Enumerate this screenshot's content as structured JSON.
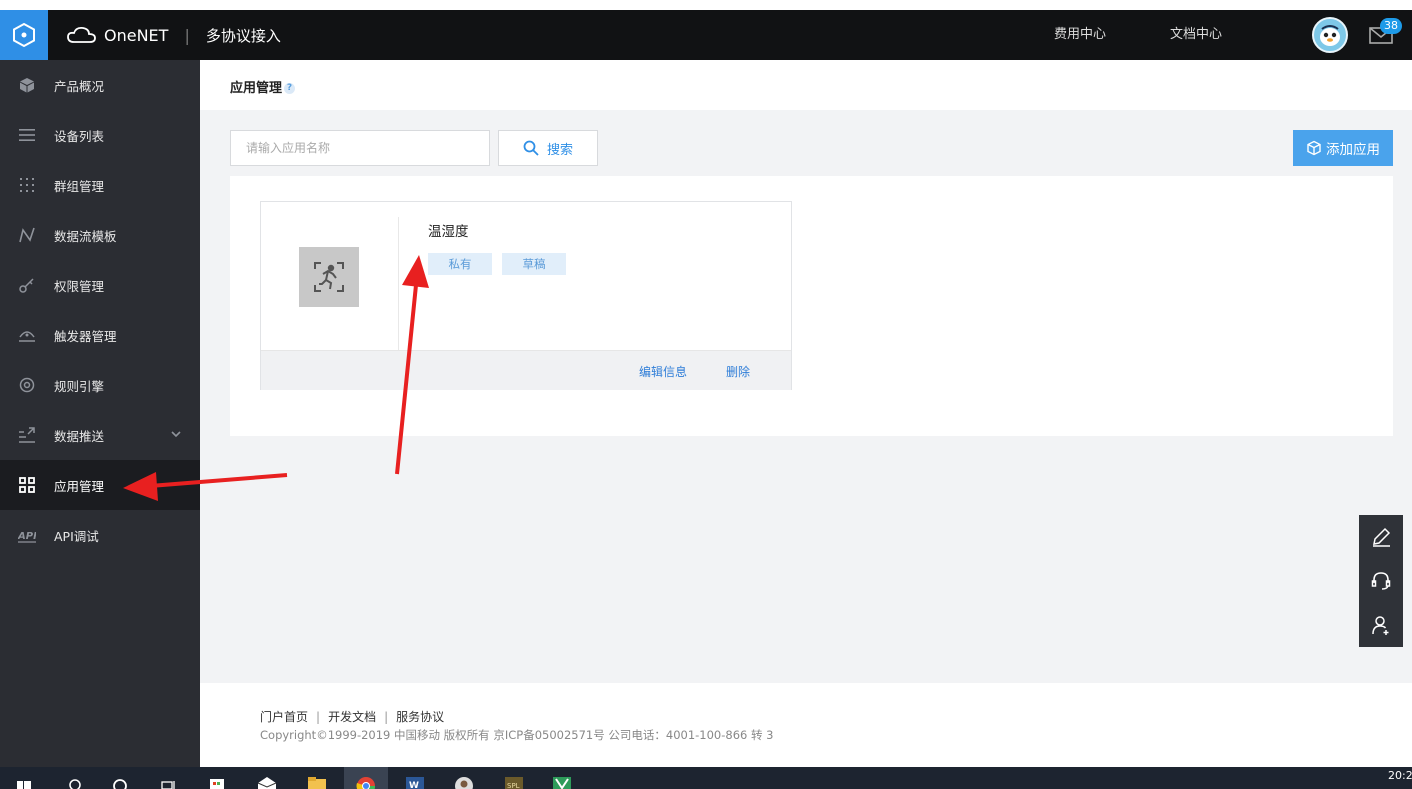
{
  "header": {
    "brand": "OneNET",
    "product": "多协议接入",
    "links": [
      "费用中心",
      "文档中心"
    ],
    "mail_count": "38"
  },
  "sidebar": {
    "items": [
      {
        "label": "产品概况",
        "icon": "cube-icon"
      },
      {
        "label": "设备列表",
        "icon": "list-icon"
      },
      {
        "label": "群组管理",
        "icon": "dots-grid-icon"
      },
      {
        "label": "数据流模板",
        "icon": "stream-icon"
      },
      {
        "label": "权限管理",
        "icon": "key-icon"
      },
      {
        "label": "触发器管理",
        "icon": "trigger-icon"
      },
      {
        "label": "规则引擎",
        "icon": "rule-engine-icon"
      },
      {
        "label": "数据推送",
        "icon": "push-icon"
      },
      {
        "label": "应用管理",
        "icon": "apps-grid-icon"
      },
      {
        "label": "API调试",
        "icon": "api-icon"
      }
    ],
    "active_index": 8
  },
  "page": {
    "title": "应用管理",
    "help": "?"
  },
  "toolbar": {
    "search_placeholder": "请输入应用名称",
    "search_label": "搜索",
    "add_label": "添加应用"
  },
  "app_card": {
    "name": "温湿度",
    "tags": [
      "私有",
      "草稿"
    ],
    "actions": [
      "编辑信息",
      "删除"
    ]
  },
  "footer": {
    "links": [
      "门户首页",
      "开发文档",
      "服务协议"
    ],
    "copyright": "Copyright©1999-2019 中国移动 版权所有 京ICP备05002571号 公司电话：4001-100-866 转 3"
  },
  "taskbar": {
    "clock": "20:2"
  },
  "colors": {
    "accent": "#2f8fe6",
    "sidebar_bg": "#2b2d33",
    "topbar_bg": "#111214",
    "annotation_arrow": "#e82020"
  }
}
